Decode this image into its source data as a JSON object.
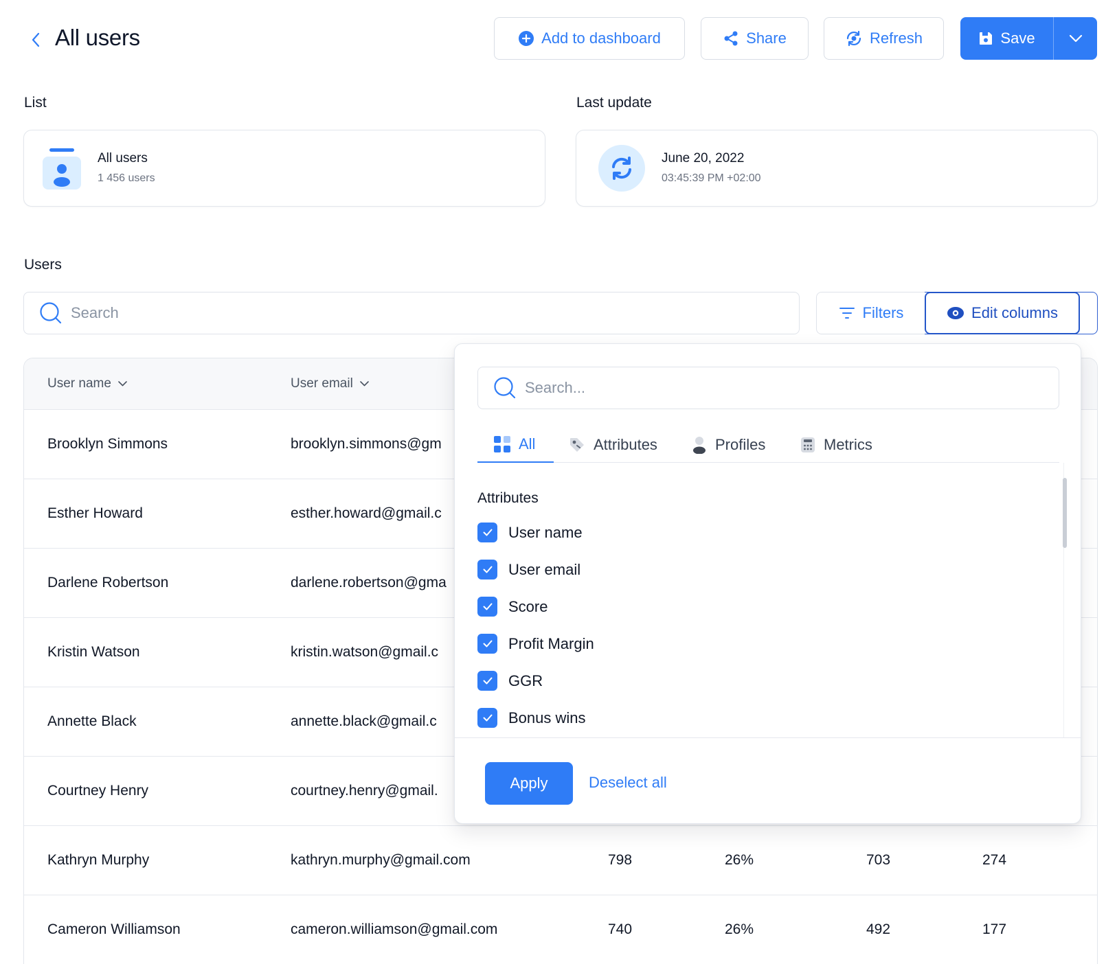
{
  "header": {
    "title": "All users",
    "add_to_dashboard": "Add to dashboard",
    "share": "Share",
    "refresh": "Refresh",
    "save": "Save"
  },
  "list_section": {
    "label": "List",
    "card_title": "All users",
    "card_subtitle": "1 456 users"
  },
  "update_section": {
    "label": "Last update",
    "date": "June 20, 2022",
    "time": "03:45:39 PM +02:00"
  },
  "users_section": {
    "label": "Users",
    "search_placeholder": "Search",
    "filters": "Filters",
    "edit_columns": "Edit columns"
  },
  "table": {
    "columns": [
      "User name",
      "User email"
    ],
    "rows": [
      {
        "name": "Brooklyn Simmons",
        "email": "brooklyn.simmons@gm",
        "score": "",
        "margin": "",
        "ggr": "",
        "bonus": ""
      },
      {
        "name": "Esther Howard",
        "email": "esther.howard@gmail.c",
        "score": "",
        "margin": "",
        "ggr": "",
        "bonus": ""
      },
      {
        "name": "Darlene Robertson",
        "email": "darlene.robertson@gma",
        "score": "",
        "margin": "",
        "ggr": "",
        "bonus": ""
      },
      {
        "name": "Kristin Watson",
        "email": "kristin.watson@gmail.c",
        "score": "",
        "margin": "",
        "ggr": "",
        "bonus": ""
      },
      {
        "name": "Annette Black",
        "email": "annette.black@gmail.c",
        "score": "",
        "margin": "",
        "ggr": "",
        "bonus": ""
      },
      {
        "name": "Courtney Henry",
        "email": "courtney.henry@gmail.",
        "score": "",
        "margin": "",
        "ggr": "",
        "bonus": ""
      },
      {
        "name": "Kathryn Murphy",
        "email": "kathryn.murphy@gmail.com",
        "score": "798",
        "margin": "26%",
        "ggr": "703",
        "bonus": "274"
      },
      {
        "name": "Cameron Williamson",
        "email": "cameron.williamson@gmail.com",
        "score": "740",
        "margin": "26%",
        "ggr": "492",
        "bonus": "177"
      }
    ]
  },
  "dropdown": {
    "search_placeholder": "Search...",
    "tabs": [
      "All",
      "Attributes",
      "Profiles",
      "Metrics"
    ],
    "active_tab": "All",
    "group_heading": "Attributes",
    "options": [
      "User name",
      "User email",
      "Score",
      "Profit Margin",
      "GGR",
      "Bonus wins"
    ],
    "apply": "Apply",
    "deselect_all": "Deselect all"
  },
  "colors": {
    "accent": "#2f7cf6",
    "accent_dark": "#1f4fc0",
    "border": "#e2e6ec",
    "icon_bg": "#dbeeff"
  }
}
